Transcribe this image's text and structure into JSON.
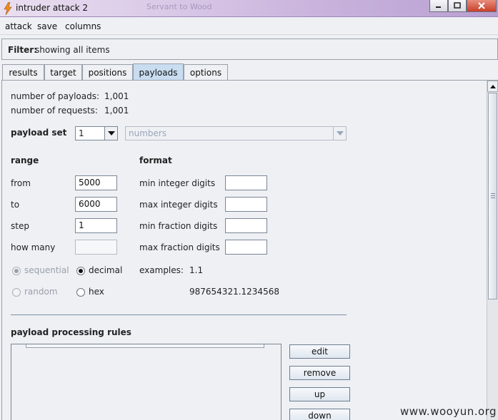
{
  "window": {
    "title": "intruder attack 2",
    "ghost_text": "Servant to Wood"
  },
  "menu": {
    "items": [
      {
        "label": "attack"
      },
      {
        "label": "save"
      },
      {
        "label": "columns"
      }
    ]
  },
  "filter": {
    "label": "Filter:",
    "value": "showing all items"
  },
  "tabs": [
    {
      "label": "results",
      "active": false
    },
    {
      "label": "target",
      "active": false
    },
    {
      "label": "positions",
      "active": false
    },
    {
      "label": "payloads",
      "active": true
    },
    {
      "label": "options",
      "active": false
    }
  ],
  "summary": {
    "payloads_label": "number of payloads:",
    "payloads_value": "1,001",
    "requests_label": "number of requests:",
    "requests_value": "1,001"
  },
  "payload_set": {
    "label": "payload set",
    "set_value": "1",
    "type_value": "numbers"
  },
  "range": {
    "heading": "range",
    "from_label": "from",
    "from_value": "5000",
    "to_label": "to",
    "to_value": "6000",
    "step_label": "step",
    "step_value": "1",
    "howmany_label": "how many",
    "howmany_value": ""
  },
  "format": {
    "heading": "format",
    "min_int_label": "min integer digits",
    "max_int_label": "max integer digits",
    "min_frac_label": "min fraction digits",
    "max_frac_label": "max fraction digits",
    "min_int_value": "",
    "max_int_value": "",
    "min_frac_value": "",
    "max_frac_value": ""
  },
  "order": {
    "sequential_label": "sequential",
    "random_label": "random",
    "selected": "sequential"
  },
  "base": {
    "decimal_label": "decimal",
    "hex_label": "hex",
    "selected": "decimal"
  },
  "examples": {
    "label": "examples:",
    "value1": "1.1",
    "value2": "987654321.1234568"
  },
  "processing": {
    "heading": "payload processing rules",
    "buttons": [
      {
        "label": "edit"
      },
      {
        "label": "remove"
      },
      {
        "label": "up"
      },
      {
        "label": "down"
      }
    ]
  },
  "watermark": "www.wooyun.org",
  "colors": {
    "active_tab": "#c9ddf1",
    "title_gradient_end": "#b89fd2",
    "separator": "#7f8fa6"
  }
}
